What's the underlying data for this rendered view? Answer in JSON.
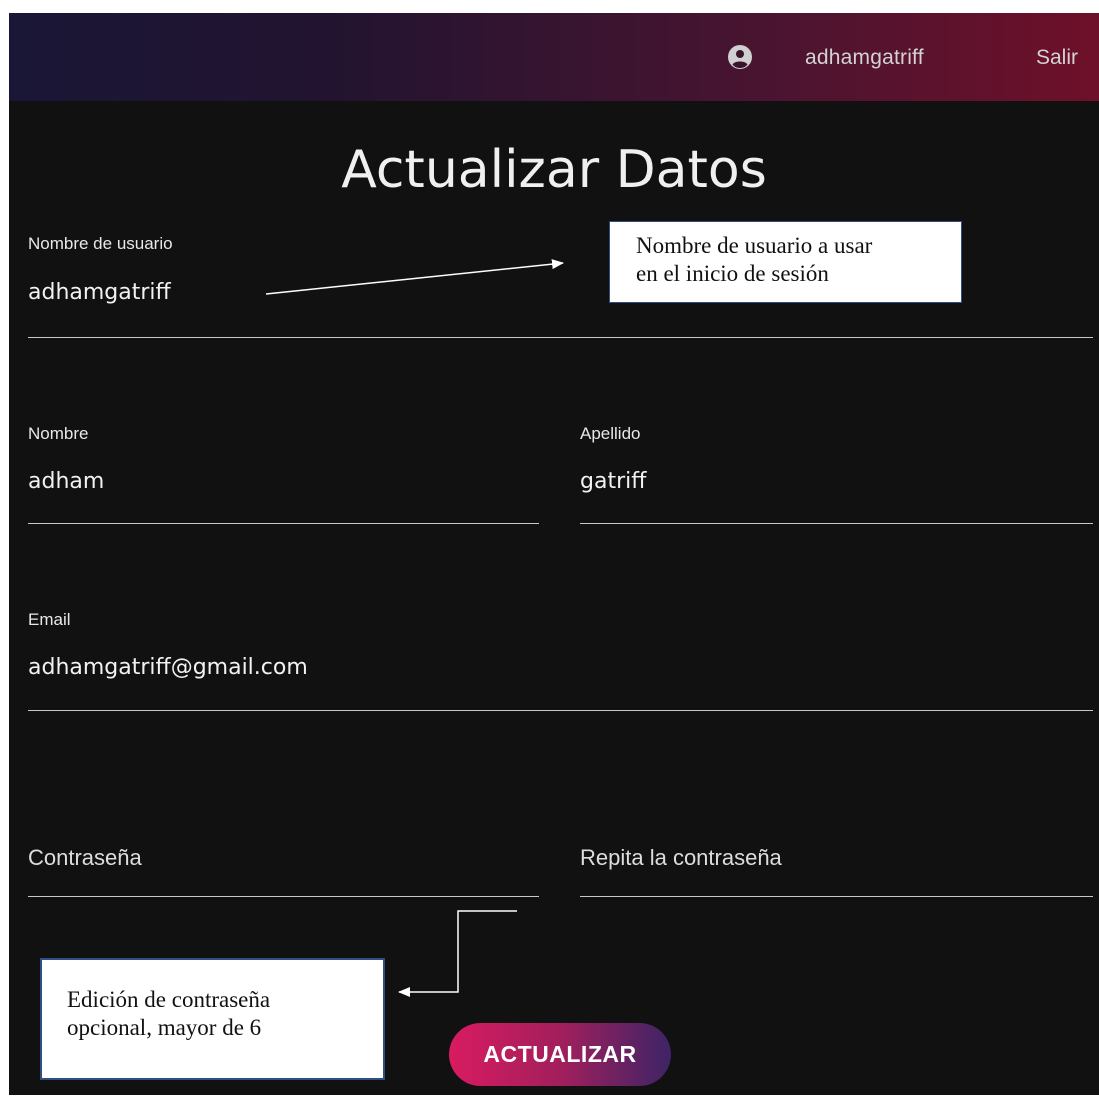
{
  "header": {
    "username": "adhamgatriff",
    "logout_label": "Salir"
  },
  "page": {
    "title": "Actualizar Datos"
  },
  "form": {
    "username_label": "Nombre de usuario",
    "username_value": "adhamgatriff",
    "first_name_label": "Nombre",
    "first_name_value": "adham",
    "last_name_label": "Apellido",
    "last_name_value": "gatriff",
    "email_label": "Email",
    "email_value": "adhamgatriff@gmail.com",
    "password_placeholder": "Contraseña",
    "password_repeat_placeholder": "Repita la contraseña",
    "submit_label": "ACTUALIZAR"
  },
  "annotations": {
    "username_note_line1": "Nombre de usuario a usar",
    "username_note_line2": "en el inicio de sesión",
    "password_note_line1": "Edición de contraseña",
    "password_note_line2": "opcional, mayor de 6"
  },
  "colors": {
    "accent_pink": "#d81b60",
    "accent_purple": "#3d2466",
    "background": "#121112"
  },
  "icons": {
    "user": "account-circle-icon"
  }
}
